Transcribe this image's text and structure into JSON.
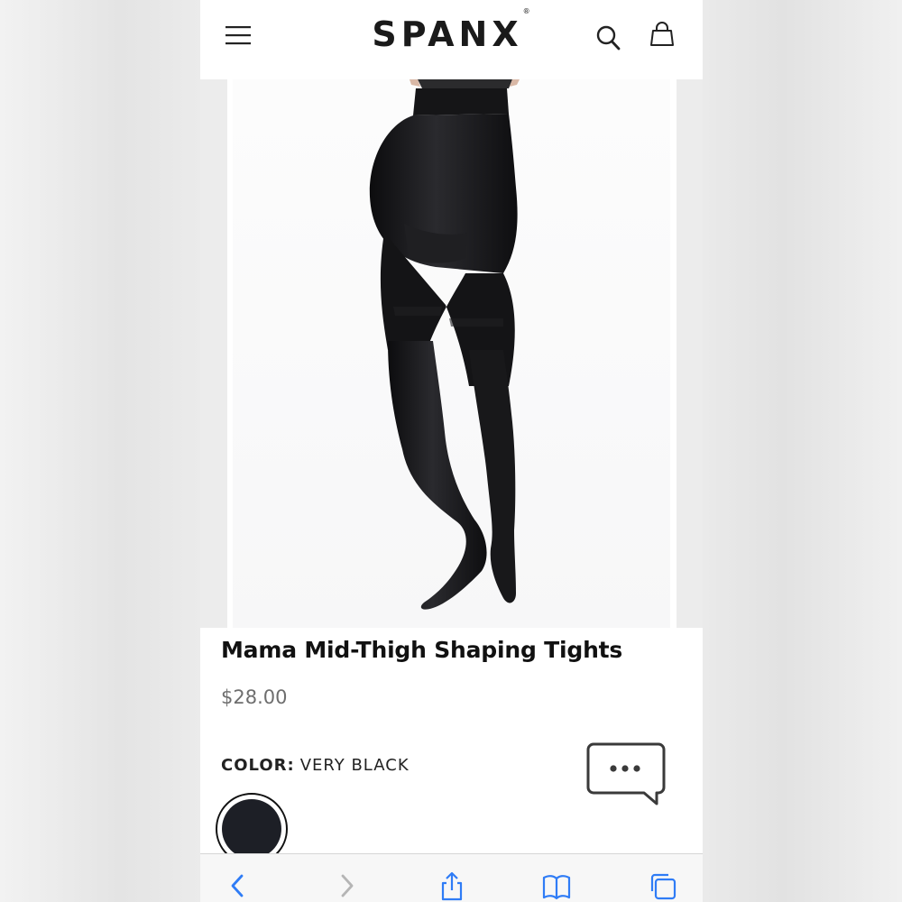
{
  "header": {
    "logo": "SPANX",
    "logo_mark": "®",
    "icons": {
      "menu": "hamburger-menu-icon",
      "search": "search-icon",
      "bag": "shopping-bag-icon"
    }
  },
  "product": {
    "image_alt": "Model wearing black maternity shaping tights",
    "title": "Mama Mid-Thigh Shaping Tights",
    "price": "$28.00",
    "color_label": "COLOR:",
    "color_value": "VERY BLACK",
    "swatch_color": "#1d1f26"
  },
  "chat": {
    "icon": "chat-bubble-icon",
    "dots": "•••"
  },
  "browser_bar": {
    "icons": [
      "back-icon",
      "forward-icon",
      "share-icon",
      "bookmarks-icon",
      "tabs-icon"
    ],
    "accent": "#2f7cf6",
    "disabled": "#b5b5b5"
  }
}
